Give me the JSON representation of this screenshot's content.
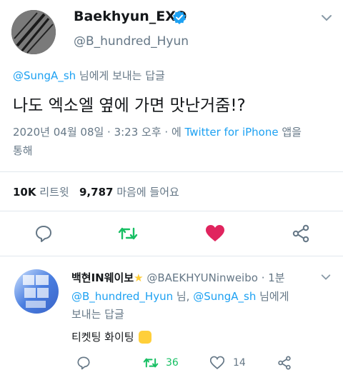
{
  "main_tweet": {
    "author_name": "Baekhyun_EXO",
    "author_handle": "@B_hundred_Hyun",
    "reply_to_handle": "@SungA_sh",
    "reply_to_suffix": " 님에게 보내는 답글",
    "text": "나도 엑소엘 옆에 가면 맛난거줌!?",
    "timestamp": "2020년 04월 08일 · 3:23 오후 · 에 ",
    "source_link": "Twitter for iPhone",
    "source_suffix": " 앱을",
    "source_suffix2": "통해",
    "retweet_count": "10K",
    "retweet_label": "리트윗",
    "like_count": "9,787",
    "like_label": "마음에 들어요"
  },
  "reply_tweet": {
    "author_name": "백현IN웨이보",
    "author_handle": "@BAEKHYUNinweibo",
    "time": " · 1분",
    "mention1": "@B_hundred_Hyun",
    "mention_sep": " 님, ",
    "mention2": "@SungA_sh",
    "mention_suffix": " 님에게",
    "line2": "보내는 답글",
    "text": "티켓팅 화이팅",
    "retweets": "36",
    "likes": "14"
  },
  "colors": {
    "accent": "#1da1f2",
    "retweet_green": "#17bf63",
    "like_red": "#e0245e",
    "muted": "#657786"
  },
  "icons": [
    "verified-badge-icon",
    "chevron-down-icon",
    "reply-icon",
    "retweet-icon",
    "heart-icon",
    "share-icon",
    "star-emoji-icon",
    "fist-emoji-icon"
  ]
}
